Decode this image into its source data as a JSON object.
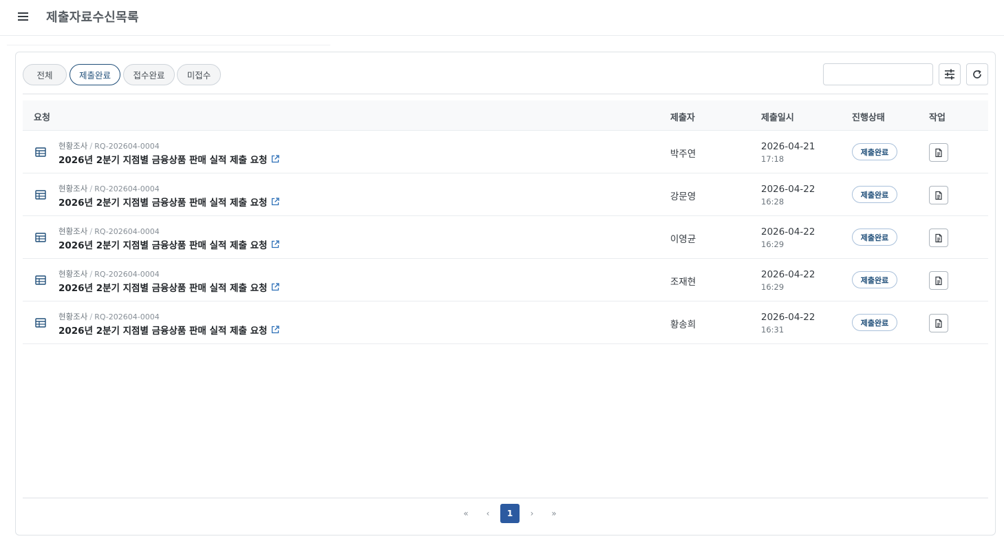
{
  "header": {
    "menu_icon": "hamburger-menu-icon",
    "title": "제출자료수신목록"
  },
  "filters": [
    {
      "label": "전체",
      "active": false
    },
    {
      "label": "제출완료",
      "active": true
    },
    {
      "label": "접수완료",
      "active": false
    },
    {
      "label": "미접수",
      "active": false
    }
  ],
  "search": {
    "value": "",
    "placeholder": ""
  },
  "toolbar": {
    "filter_icon": "sliders-icon",
    "refresh_icon": "refresh-icon"
  },
  "table": {
    "columns": {
      "request": "요청",
      "submitter": "제출자",
      "submitted_at": "제출일시",
      "status": "진행상태",
      "action": "작업"
    },
    "rows": [
      {
        "category": "현황조사",
        "separator": "/",
        "code": "RQ-202604-0004",
        "title": "2026년 2분기 지점별 금융상품 판매 실적 제출 요청",
        "submitter": "박주연",
        "date": "2026-04-21",
        "time": "17:18",
        "status": "제출완료"
      },
      {
        "category": "현황조사",
        "separator": "/",
        "code": "RQ-202604-0004",
        "title": "2026년 2분기 지점별 금융상품 판매 실적 제출 요청",
        "submitter": "강문영",
        "date": "2026-04-22",
        "time": "16:28",
        "status": "제출완료"
      },
      {
        "category": "현황조사",
        "separator": "/",
        "code": "RQ-202604-0004",
        "title": "2026년 2분기 지점별 금융상품 판매 실적 제출 요청",
        "submitter": "이영균",
        "date": "2026-04-22",
        "time": "16:29",
        "status": "제출완료"
      },
      {
        "category": "현황조사",
        "separator": "/",
        "code": "RQ-202604-0004",
        "title": "2026년 2분기 지점별 금융상품 판매 실적 제출 요청",
        "submitter": "조재현",
        "date": "2026-04-22",
        "time": "16:29",
        "status": "제출완료"
      },
      {
        "category": "현황조사",
        "separator": "/",
        "code": "RQ-202604-0004",
        "title": "2026년 2분기 지점별 금융상품 판매 실적 제출 요청",
        "submitter": "황송희",
        "date": "2026-04-22",
        "time": "16:31",
        "status": "제출완료"
      }
    ]
  },
  "pagination": {
    "first": "«",
    "prev": "‹",
    "current": "1",
    "next": "›",
    "last": "»"
  },
  "colors": {
    "accent": "#1f4e79",
    "page_active": "#2c5aa0"
  }
}
